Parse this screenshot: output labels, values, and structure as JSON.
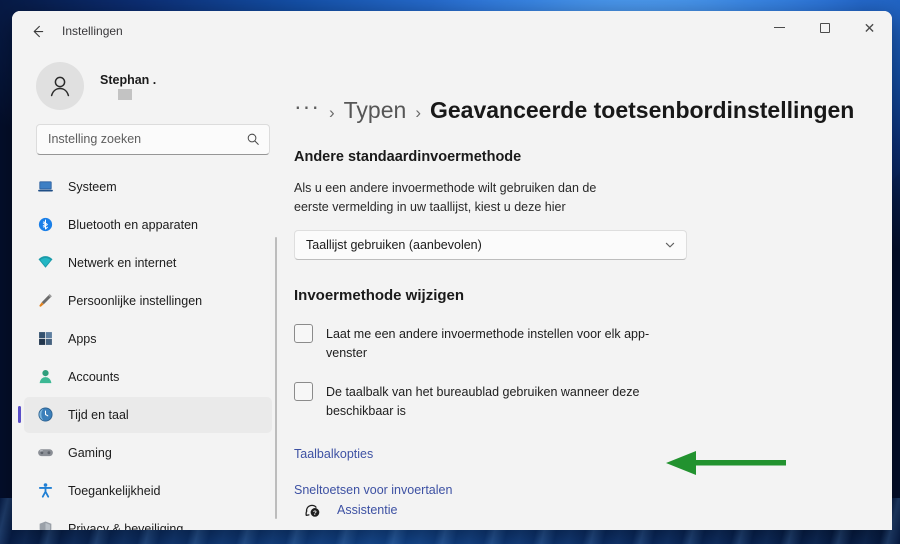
{
  "window": {
    "app_title": "Instellingen",
    "back_icon": "back-arrow-icon",
    "controls": {
      "minimize": "minimize-icon",
      "maximize": "maximize-icon",
      "close": "close-icon"
    }
  },
  "sidebar": {
    "profile": {
      "name": "Stephan .",
      "avatar_icon": "person-avatar-icon"
    },
    "search": {
      "placeholder": "Instelling zoeken",
      "value": "",
      "icon": "search-icon"
    },
    "items": [
      {
        "label": "Systeem",
        "icon": "system-laptop-icon",
        "selected": false
      },
      {
        "label": "Bluetooth en apparaten",
        "icon": "bluetooth-icon",
        "selected": false
      },
      {
        "label": "Netwerk en internet",
        "icon": "wifi-icon",
        "selected": false
      },
      {
        "label": "Persoonlijke instellingen",
        "icon": "paintbrush-icon",
        "selected": false
      },
      {
        "label": "Apps",
        "icon": "apps-grid-icon",
        "selected": false
      },
      {
        "label": "Accounts",
        "icon": "account-person-icon",
        "selected": false
      },
      {
        "label": "Tijd en taal",
        "icon": "clock-globe-icon",
        "selected": true
      },
      {
        "label": "Gaming",
        "icon": "gamepad-icon",
        "selected": false
      },
      {
        "label": "Toegankelijkheid",
        "icon": "accessibility-person-icon",
        "selected": false
      },
      {
        "label": "Privacy & beveiliging",
        "icon": "shield-icon",
        "selected": false
      }
    ]
  },
  "main": {
    "breadcrumb": {
      "overflow": "···",
      "separator": "›",
      "parent": "Typen",
      "current": "Geavanceerde toetsenbordinstellingen"
    },
    "section_default_input": {
      "title": "Andere standaardinvoermethode",
      "description": "Als u een andere invoermethode wilt gebruiken dan de eerste vermelding in uw taallijst, kiest u deze hier",
      "dropdown_value": "Taallijst gebruiken (aanbevolen)",
      "dropdown_icon": "chevron-down-icon"
    },
    "section_switch_input": {
      "title": "Invoermethode wijzigen",
      "checkboxes": [
        {
          "label": "Laat me een andere invoermethode instellen voor elk app-venster",
          "checked": false
        },
        {
          "label": "De taalbalk van het bureaublad gebruiken wanneer deze beschikbaar is",
          "checked": false
        }
      ],
      "links": [
        "Taalbalkopties",
        "Sneltoetsen voor invoertalen"
      ]
    },
    "annotation": {
      "type": "arrow-left",
      "color": "#22922f",
      "points_at": "Taalbalkopties"
    }
  },
  "footer": {
    "assistance_label": "Assistentie",
    "assistance_icon": "help-question-icon"
  },
  "colors": {
    "window_bg": "#f3f3f3",
    "accent": "#5a4ec8",
    "link": "#3d51a3",
    "annotation_green": "#22922f"
  }
}
